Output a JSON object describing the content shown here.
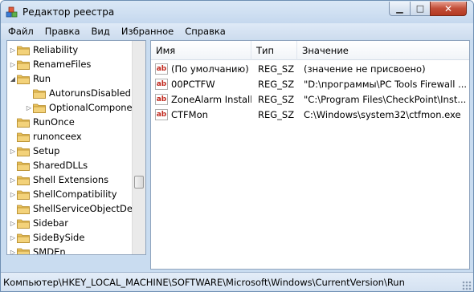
{
  "window": {
    "title": "Редактор реестра"
  },
  "menu": [
    "Файл",
    "Правка",
    "Вид",
    "Избранное",
    "Справка"
  ],
  "tree": {
    "items": [
      {
        "label": "Reliability",
        "arrow": "▷",
        "indent": 0
      },
      {
        "label": "RenameFiles",
        "arrow": "▷",
        "indent": 0
      },
      {
        "label": "Run",
        "arrow": "◢",
        "indent": 0
      },
      {
        "label": "AutorunsDisabled",
        "arrow": "",
        "indent": 1
      },
      {
        "label": "OptionalCompone",
        "arrow": "▷",
        "indent": 1
      },
      {
        "label": "RunOnce",
        "arrow": "",
        "indent": 0
      },
      {
        "label": "runonceex",
        "arrow": "",
        "indent": 0
      },
      {
        "label": "Setup",
        "arrow": "▷",
        "indent": 0
      },
      {
        "label": "SharedDLLs",
        "arrow": "",
        "indent": 0
      },
      {
        "label": "Shell Extensions",
        "arrow": "▷",
        "indent": 0
      },
      {
        "label": "ShellCompatibility",
        "arrow": "▷",
        "indent": 0
      },
      {
        "label": "ShellServiceObjectDela",
        "arrow": "",
        "indent": 0
      },
      {
        "label": "Sidebar",
        "arrow": "▷",
        "indent": 0
      },
      {
        "label": "SideBySide",
        "arrow": "▷",
        "indent": 0
      },
      {
        "label": "SMDEn",
        "arrow": "▷",
        "indent": 0
      }
    ]
  },
  "list": {
    "columns": {
      "name": "Имя",
      "type": "Тип",
      "value": "Значение"
    },
    "rows": [
      {
        "name": "(По умолчанию)",
        "type": "REG_SZ",
        "value": "(значение не присвоено)"
      },
      {
        "name": "00PCTFW",
        "type": "REG_SZ",
        "value": "\"D:\\программы\\PC Tools Firewall ..."
      },
      {
        "name": "ZoneAlarm Installer",
        "type": "REG_SZ",
        "value": "\"C:\\Program Files\\CheckPoint\\Inst..."
      },
      {
        "name": "CTFMon",
        "type": "REG_SZ",
        "value": "C:\\Windows\\system32\\ctfmon.exe"
      }
    ],
    "icon_text": "ab"
  },
  "status": {
    "path": "Компьютер\\HKEY_LOCAL_MACHINE\\SOFTWARE\\Microsoft\\Windows\\CurrentVersion\\Run"
  },
  "colors": {
    "folder": "#e9c15a",
    "accent": "#c24e38"
  }
}
